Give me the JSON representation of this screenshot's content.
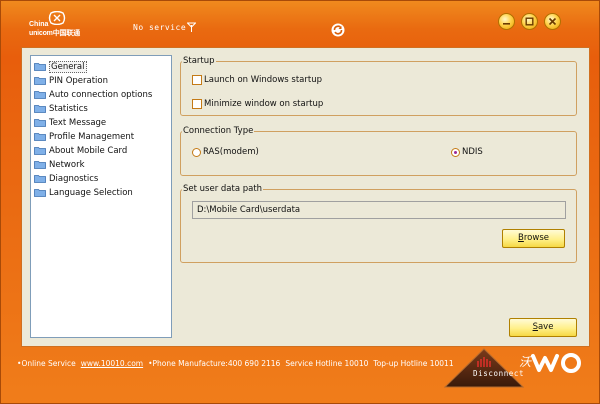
{
  "titlebar": {
    "logo_line1": "China",
    "logo_line2": "unicom中国联通",
    "status": "No service",
    "icons": {
      "signal": "signal-icon",
      "refresh": "refresh-icon"
    }
  },
  "window_buttons": {
    "minimize": "minimize-icon",
    "maximize": "maximize-icon",
    "close": "close-icon"
  },
  "sidebar": {
    "items": [
      {
        "label": "General",
        "selected": true
      },
      {
        "label": "PIN Operation"
      },
      {
        "label": "Auto connection options"
      },
      {
        "label": "Statistics"
      },
      {
        "label": "Text Message"
      },
      {
        "label": "Profile Management"
      },
      {
        "label": "About Mobile Card"
      },
      {
        "label": "Network"
      },
      {
        "label": "Diagnostics"
      },
      {
        "label": "Language Selection"
      }
    ]
  },
  "startup": {
    "title": "Startup",
    "launch_label": "Launch on Windows startup",
    "launch_checked": false,
    "minimize_label": "Minimize window on startup",
    "minimize_checked": false
  },
  "connection_type": {
    "title": "Connection Type",
    "ras_label": "RAS(modem)",
    "ndis_label": "NDIS",
    "selected": "NDIS"
  },
  "data_path": {
    "title": "Set user data path",
    "value": "D:\\Mobile Card\\userdata",
    "browse_rest": "rowse",
    "browse_mnemonic": "B"
  },
  "save_button": {
    "mnemonic": "S",
    "rest": "ave"
  },
  "footer": {
    "online_label": "Online Service",
    "online_link": "www.10010.com",
    "manufacture": "Phone Manufacture:400 690 2116",
    "service_hotline": "Service Hotline 10010",
    "topup_hotline": "Top-up Hotline 10011"
  },
  "disconnect": {
    "label": "Disconnect"
  },
  "colors": {
    "accent": "#e9650f",
    "button": "#fff08a",
    "panel": "#ece9d8"
  }
}
